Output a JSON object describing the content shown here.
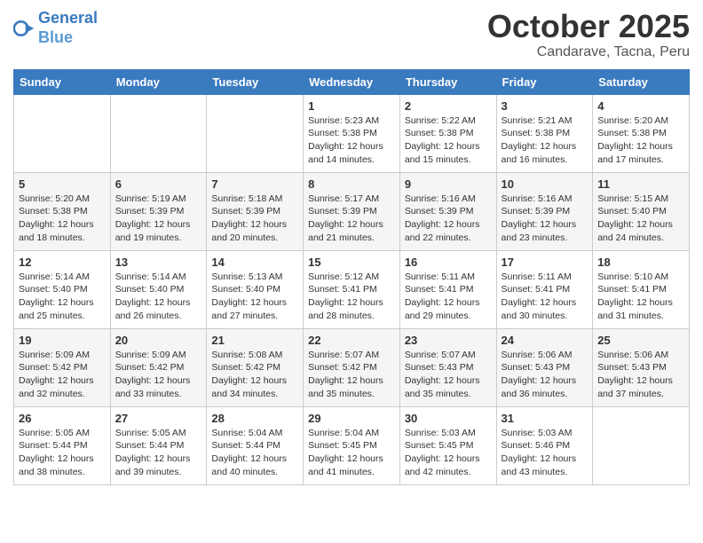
{
  "header": {
    "logo_line1": "General",
    "logo_line2": "Blue",
    "month": "October 2025",
    "location": "Candarave, Tacna, Peru"
  },
  "weekdays": [
    "Sunday",
    "Monday",
    "Tuesday",
    "Wednesday",
    "Thursday",
    "Friday",
    "Saturday"
  ],
  "weeks": [
    [
      {
        "day": "",
        "info": ""
      },
      {
        "day": "",
        "info": ""
      },
      {
        "day": "",
        "info": ""
      },
      {
        "day": "1",
        "info": "Sunrise: 5:23 AM\nSunset: 5:38 PM\nDaylight: 12 hours\nand 14 minutes."
      },
      {
        "day": "2",
        "info": "Sunrise: 5:22 AM\nSunset: 5:38 PM\nDaylight: 12 hours\nand 15 minutes."
      },
      {
        "day": "3",
        "info": "Sunrise: 5:21 AM\nSunset: 5:38 PM\nDaylight: 12 hours\nand 16 minutes."
      },
      {
        "day": "4",
        "info": "Sunrise: 5:20 AM\nSunset: 5:38 PM\nDaylight: 12 hours\nand 17 minutes."
      }
    ],
    [
      {
        "day": "5",
        "info": "Sunrise: 5:20 AM\nSunset: 5:38 PM\nDaylight: 12 hours\nand 18 minutes."
      },
      {
        "day": "6",
        "info": "Sunrise: 5:19 AM\nSunset: 5:39 PM\nDaylight: 12 hours\nand 19 minutes."
      },
      {
        "day": "7",
        "info": "Sunrise: 5:18 AM\nSunset: 5:39 PM\nDaylight: 12 hours\nand 20 minutes."
      },
      {
        "day": "8",
        "info": "Sunrise: 5:17 AM\nSunset: 5:39 PM\nDaylight: 12 hours\nand 21 minutes."
      },
      {
        "day": "9",
        "info": "Sunrise: 5:16 AM\nSunset: 5:39 PM\nDaylight: 12 hours\nand 22 minutes."
      },
      {
        "day": "10",
        "info": "Sunrise: 5:16 AM\nSunset: 5:39 PM\nDaylight: 12 hours\nand 23 minutes."
      },
      {
        "day": "11",
        "info": "Sunrise: 5:15 AM\nSunset: 5:40 PM\nDaylight: 12 hours\nand 24 minutes."
      }
    ],
    [
      {
        "day": "12",
        "info": "Sunrise: 5:14 AM\nSunset: 5:40 PM\nDaylight: 12 hours\nand 25 minutes."
      },
      {
        "day": "13",
        "info": "Sunrise: 5:14 AM\nSunset: 5:40 PM\nDaylight: 12 hours\nand 26 minutes."
      },
      {
        "day": "14",
        "info": "Sunrise: 5:13 AM\nSunset: 5:40 PM\nDaylight: 12 hours\nand 27 minutes."
      },
      {
        "day": "15",
        "info": "Sunrise: 5:12 AM\nSunset: 5:41 PM\nDaylight: 12 hours\nand 28 minutes."
      },
      {
        "day": "16",
        "info": "Sunrise: 5:11 AM\nSunset: 5:41 PM\nDaylight: 12 hours\nand 29 minutes."
      },
      {
        "day": "17",
        "info": "Sunrise: 5:11 AM\nSunset: 5:41 PM\nDaylight: 12 hours\nand 30 minutes."
      },
      {
        "day": "18",
        "info": "Sunrise: 5:10 AM\nSunset: 5:41 PM\nDaylight: 12 hours\nand 31 minutes."
      }
    ],
    [
      {
        "day": "19",
        "info": "Sunrise: 5:09 AM\nSunset: 5:42 PM\nDaylight: 12 hours\nand 32 minutes."
      },
      {
        "day": "20",
        "info": "Sunrise: 5:09 AM\nSunset: 5:42 PM\nDaylight: 12 hours\nand 33 minutes."
      },
      {
        "day": "21",
        "info": "Sunrise: 5:08 AM\nSunset: 5:42 PM\nDaylight: 12 hours\nand 34 minutes."
      },
      {
        "day": "22",
        "info": "Sunrise: 5:07 AM\nSunset: 5:42 PM\nDaylight: 12 hours\nand 35 minutes."
      },
      {
        "day": "23",
        "info": "Sunrise: 5:07 AM\nSunset: 5:43 PM\nDaylight: 12 hours\nand 35 minutes."
      },
      {
        "day": "24",
        "info": "Sunrise: 5:06 AM\nSunset: 5:43 PM\nDaylight: 12 hours\nand 36 minutes."
      },
      {
        "day": "25",
        "info": "Sunrise: 5:06 AM\nSunset: 5:43 PM\nDaylight: 12 hours\nand 37 minutes."
      }
    ],
    [
      {
        "day": "26",
        "info": "Sunrise: 5:05 AM\nSunset: 5:44 PM\nDaylight: 12 hours\nand 38 minutes."
      },
      {
        "day": "27",
        "info": "Sunrise: 5:05 AM\nSunset: 5:44 PM\nDaylight: 12 hours\nand 39 minutes."
      },
      {
        "day": "28",
        "info": "Sunrise: 5:04 AM\nSunset: 5:44 PM\nDaylight: 12 hours\nand 40 minutes."
      },
      {
        "day": "29",
        "info": "Sunrise: 5:04 AM\nSunset: 5:45 PM\nDaylight: 12 hours\nand 41 minutes."
      },
      {
        "day": "30",
        "info": "Sunrise: 5:03 AM\nSunset: 5:45 PM\nDaylight: 12 hours\nand 42 minutes."
      },
      {
        "day": "31",
        "info": "Sunrise: 5:03 AM\nSunset: 5:46 PM\nDaylight: 12 hours\nand 43 minutes."
      },
      {
        "day": "",
        "info": ""
      }
    ]
  ]
}
